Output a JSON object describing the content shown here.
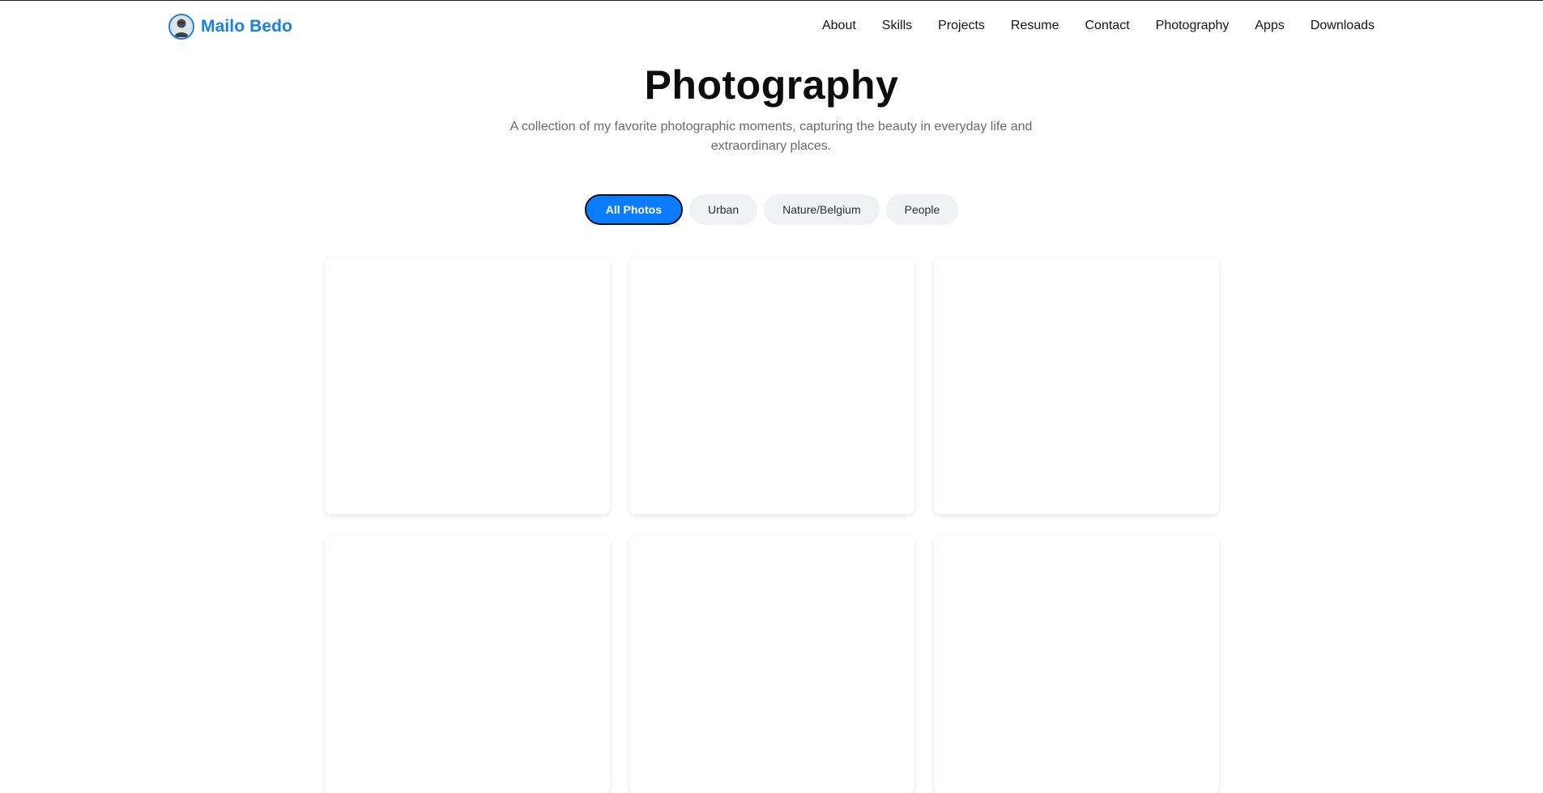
{
  "brand": {
    "name": "Mailo Bedo",
    "avatar_icon": "avatar-photo",
    "color": "#1a7fe8"
  },
  "nav": {
    "items": [
      {
        "label": "About"
      },
      {
        "label": "Skills"
      },
      {
        "label": "Projects"
      },
      {
        "label": "Resume"
      },
      {
        "label": "Contact"
      },
      {
        "label": "Photography"
      },
      {
        "label": "Apps"
      },
      {
        "label": "Downloads"
      }
    ]
  },
  "page": {
    "title": "Photography",
    "subtitle": "A collection of my favorite photographic moments, capturing the beauty in everyday life and extraordinary places."
  },
  "filters": {
    "active_color": "#0a7cff",
    "items": [
      {
        "label": "All Photos",
        "active": true
      },
      {
        "label": "Urban",
        "active": false
      },
      {
        "label": "Nature/Belgium",
        "active": false
      },
      {
        "label": "People",
        "active": false
      }
    ]
  },
  "gallery": {
    "cards_visible": 6
  }
}
